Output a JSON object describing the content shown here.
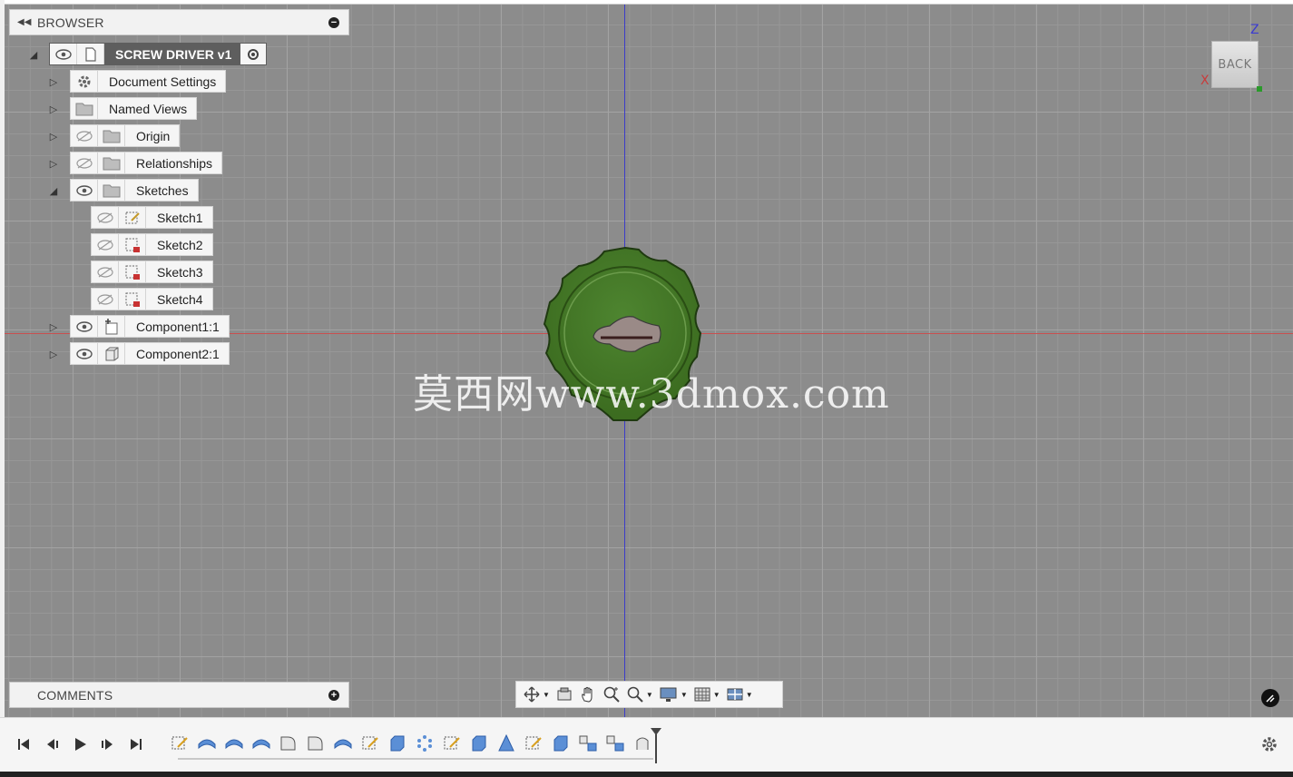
{
  "browser": {
    "title": "BROWSER",
    "root_label": "SCREW DRIVER v1",
    "items": [
      {
        "label": "Document Settings",
        "icon": "gear-icon",
        "expand": "collapsed"
      },
      {
        "label": "Named Views",
        "icon": "folder-icon",
        "expand": "collapsed"
      },
      {
        "label": "Origin",
        "icon": "folder-icon",
        "visibility": "hidden",
        "expand": "collapsed"
      },
      {
        "label": "Relationships",
        "icon": "folder-icon",
        "visibility": "hidden",
        "expand": "collapsed"
      },
      {
        "label": "Sketches",
        "icon": "folder-icon",
        "visibility": "visible",
        "expand": "expanded"
      },
      {
        "label": "Component1:1",
        "icon": "component-icon",
        "visibility": "visible",
        "expand": "collapsed"
      },
      {
        "label": "Component2:1",
        "icon": "body-icon",
        "visibility": "visible",
        "expand": "collapsed"
      }
    ],
    "sketches": [
      {
        "label": "Sketch1"
      },
      {
        "label": "Sketch2"
      },
      {
        "label": "Sketch3"
      },
      {
        "label": "Sketch4"
      }
    ]
  },
  "comments": {
    "title": "COMMENTS"
  },
  "viewcube": {
    "face": "BACK",
    "x_label": "X",
    "z_label": "Z"
  },
  "watermark": "莫西网www.3dmox.com",
  "colors": {
    "model": "#4a7a2a",
    "model_dark": "#2f5518",
    "slot": "#9a8a87",
    "viewport": "#8c8c8c"
  }
}
